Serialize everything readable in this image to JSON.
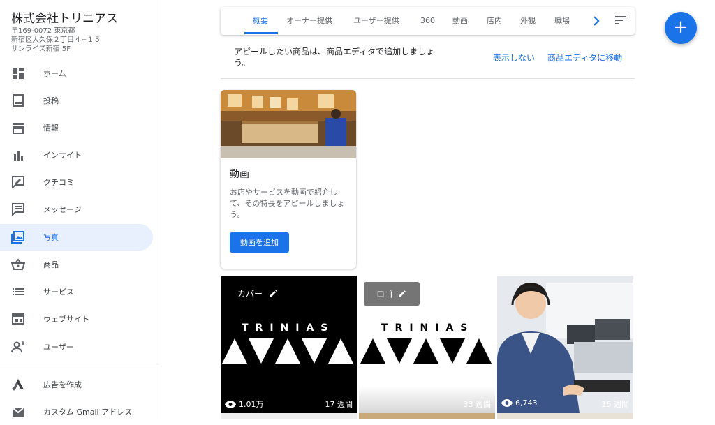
{
  "business": {
    "name": "株式会社トリニアス",
    "address_line1": "〒169-0072 東京都",
    "address_line2": "新宿区大久保２丁目４−１５",
    "address_line3": "サンライズ新宿 5F"
  },
  "sidebar": {
    "items": [
      {
        "label": "ホーム",
        "icon": "dashboard-icon"
      },
      {
        "label": "投稿",
        "icon": "post-icon"
      },
      {
        "label": "情報",
        "icon": "store-icon"
      },
      {
        "label": "インサイト",
        "icon": "bar-chart-icon"
      },
      {
        "label": "クチコミ",
        "icon": "review-icon"
      },
      {
        "label": "メッセージ",
        "icon": "message-icon"
      },
      {
        "label": "写真",
        "icon": "photo-icon",
        "active": true
      },
      {
        "label": "商品",
        "icon": "basket-icon"
      },
      {
        "label": "サービス",
        "icon": "list-icon"
      },
      {
        "label": "ウェブサイト",
        "icon": "website-icon"
      },
      {
        "label": "ユーザー",
        "icon": "add-user-icon"
      },
      {
        "label": "広告を作成",
        "icon": "ads-icon"
      },
      {
        "label": "カスタム Gmail アドレス",
        "icon": "gmail-icon"
      }
    ]
  },
  "tabs": {
    "items": [
      "概要",
      "オーナー提供",
      "ユーザー提供",
      "360",
      "動画",
      "店内",
      "外観",
      "職場"
    ],
    "active": "概要"
  },
  "banner": {
    "text": "アピールしたい商品は、商品エディタで追加しましょう。",
    "dismiss": "表示しない",
    "go_editor": "商品エディタに移動"
  },
  "video_card": {
    "title": "動画",
    "description": "お店やサービスを動画で紹介して、その特長をアピールしましょう。",
    "button": "動画を追加"
  },
  "photos": [
    {
      "label": "カバー",
      "views": "1.01万",
      "age": "17 週間",
      "brand_text": "TRINIAS"
    },
    {
      "label": "ロゴ",
      "age": "33 週間",
      "brand_text": "TRINIAS"
    },
    {
      "views": "6,743",
      "age": "15 週間"
    }
  ],
  "colors": {
    "accent": "#1a73e8",
    "active_bg": "#e8f0fe"
  }
}
